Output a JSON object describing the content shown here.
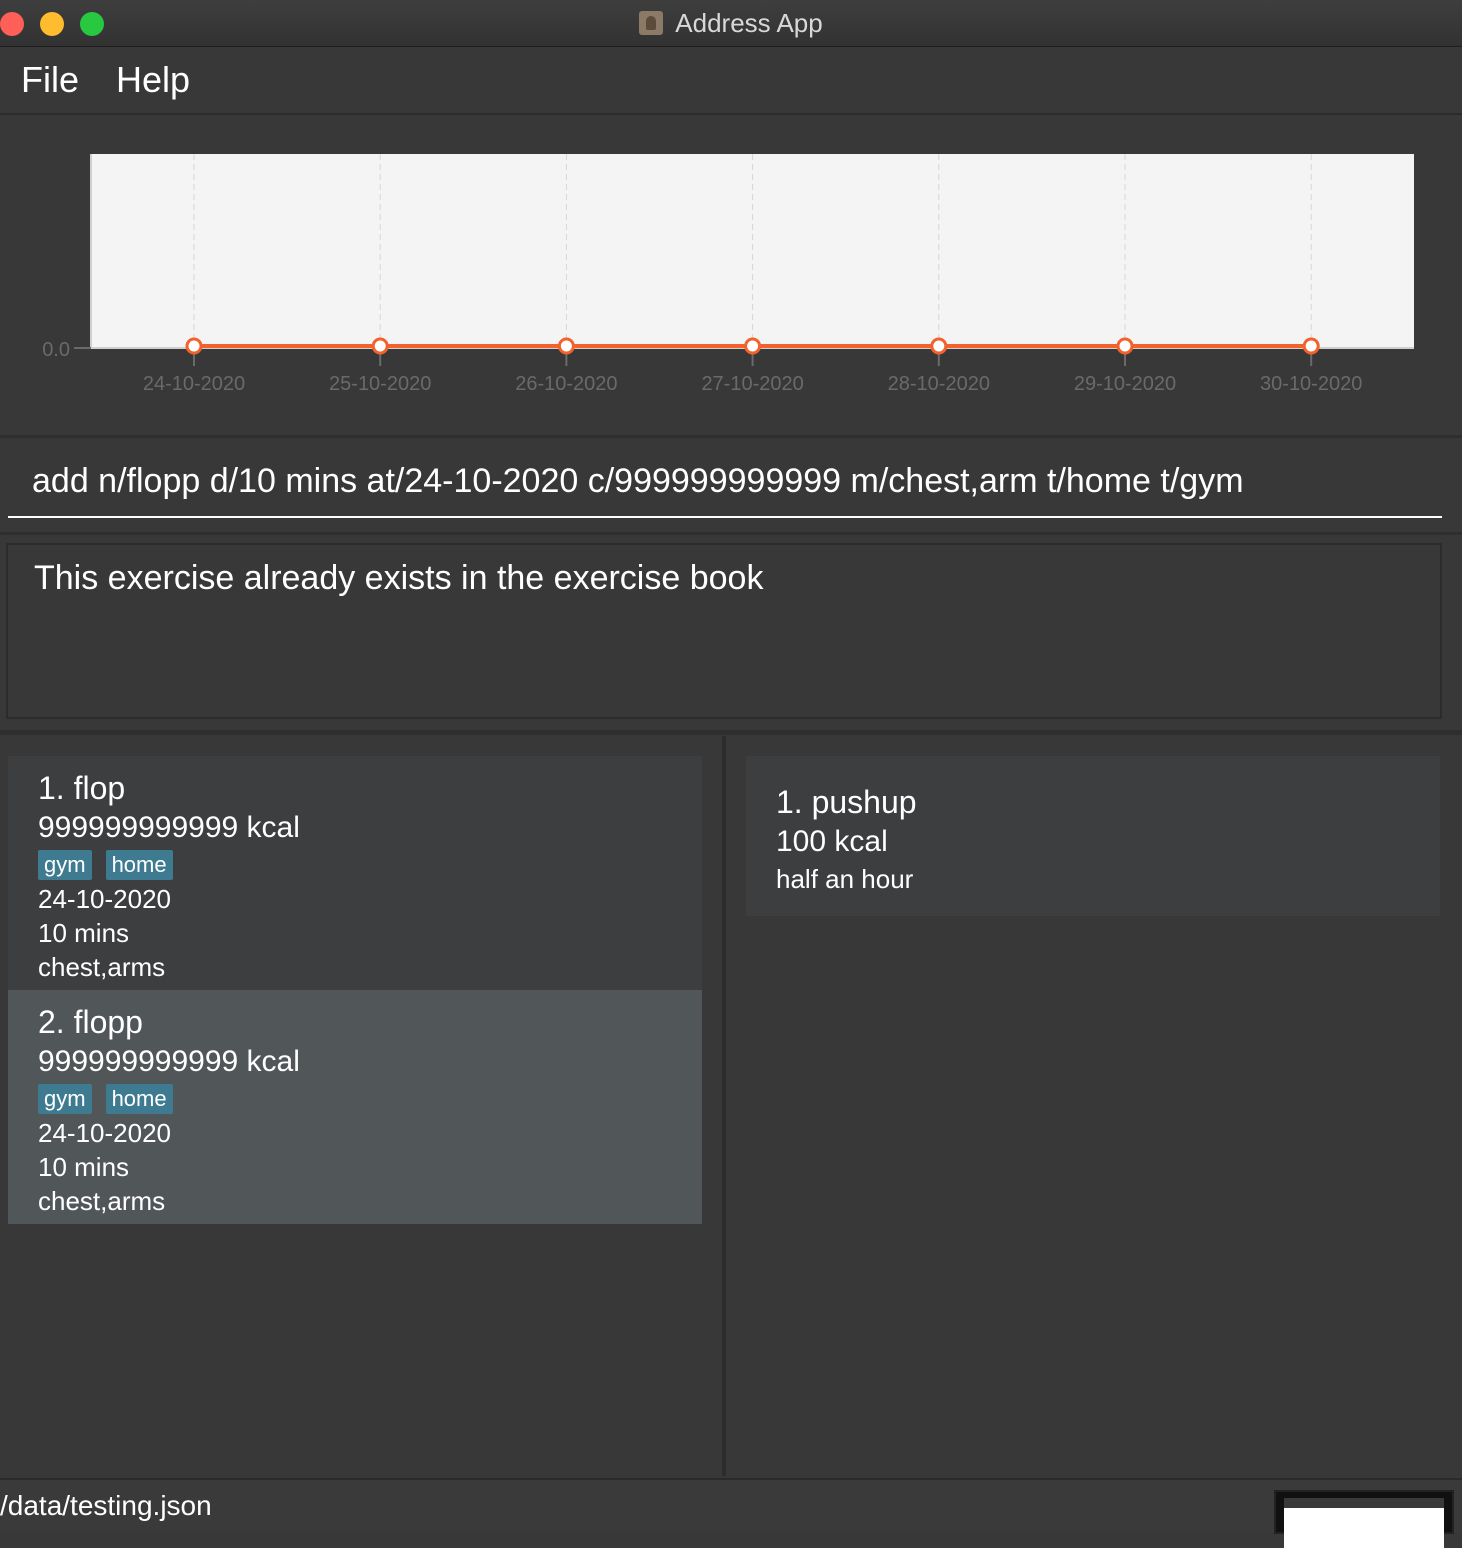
{
  "window": {
    "title": "Address App"
  },
  "menu": {
    "file": "File",
    "help": "Help"
  },
  "chart_data": {
    "type": "line",
    "categories": [
      "24-10-2020",
      "25-10-2020",
      "26-10-2020",
      "27-10-2020",
      "28-10-2020",
      "29-10-2020",
      "30-10-2020"
    ],
    "series": [
      {
        "values": [
          0,
          0,
          0,
          0,
          0,
          0,
          0
        ],
        "color": "#f3622d"
      }
    ],
    "y_ticks": [
      "0.0"
    ],
    "ylim": [
      0,
      1
    ],
    "grid": "vertical dashed",
    "title": "",
    "xlabel": "",
    "ylabel": ""
  },
  "command": {
    "value": "add n/flopp d/10 mins at/24-10-2020 c/999999999999 m/chest,arm t/home t/gym"
  },
  "result": {
    "text": "This exercise already exists in the exercise book"
  },
  "exercises": [
    {
      "title": "1.  flop",
      "calories": "999999999999  kcal",
      "tags": [
        "gym",
        "home"
      ],
      "date": "24-10-2020",
      "duration": "10 mins",
      "muscles": "chest,arms"
    },
    {
      "title": "2.  flopp",
      "calories": "999999999999  kcal",
      "tags": [
        "gym",
        "home"
      ],
      "date": "24-10-2020",
      "duration": "10 mins",
      "muscles": "chest,arms"
    }
  ],
  "templates": [
    {
      "title": "1.  pushup",
      "calories": "100  kcal",
      "duration": "half an hour"
    }
  ],
  "status": {
    "path": "/data/testing.json"
  }
}
